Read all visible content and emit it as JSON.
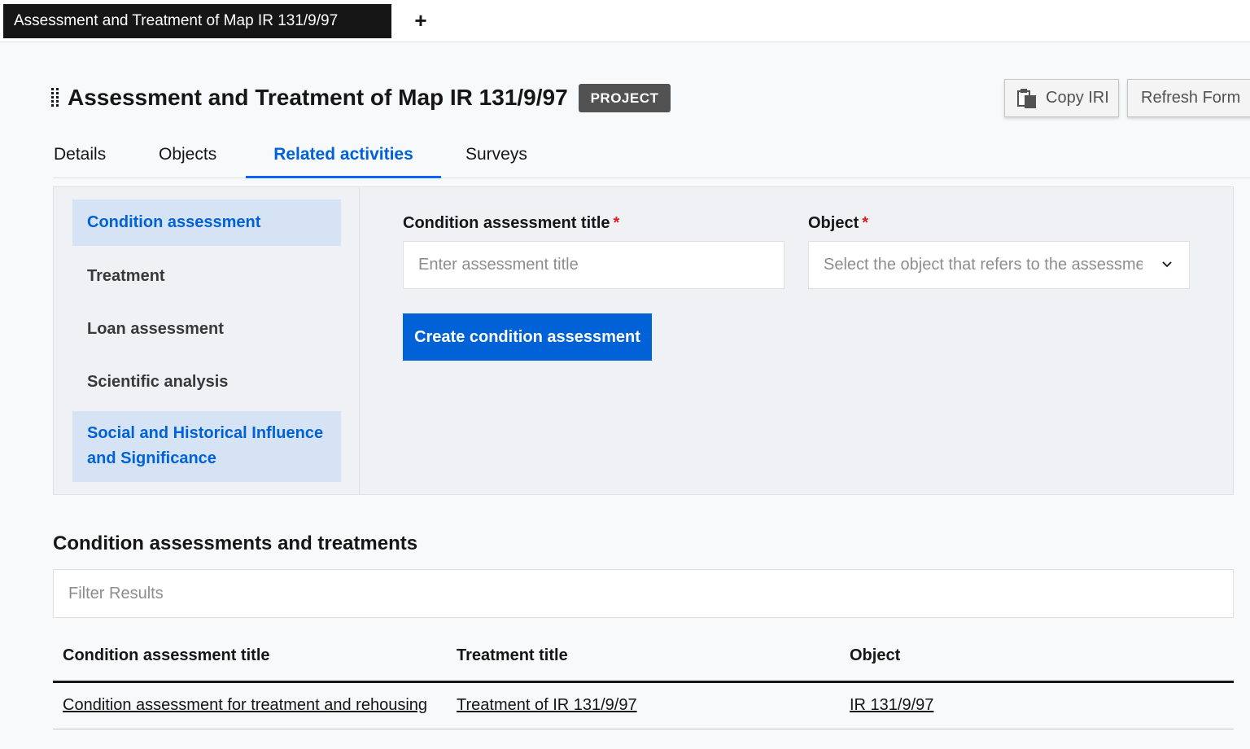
{
  "top_tabs": {
    "active_tab_label": "Assessment and Treatment of Map IR 131/9/97",
    "add_tab_symbol": "+"
  },
  "header": {
    "title": "Assessment and Treatment of Map IR 131/9/97",
    "badge": "PROJECT",
    "copy_iri_label": "Copy IRI",
    "refresh_label": "Refresh Form"
  },
  "tabs": [
    {
      "label": "Details",
      "active": false
    },
    {
      "label": "Objects",
      "active": false
    },
    {
      "label": "Related activities",
      "active": true
    },
    {
      "label": "Surveys",
      "active": false
    }
  ],
  "side_nav": [
    {
      "label": "Condition assessment",
      "selected": true
    },
    {
      "label": "Treatment",
      "selected": false
    },
    {
      "label": "Loan assessment",
      "selected": false
    },
    {
      "label": "Scientific analysis",
      "selected": false
    },
    {
      "label": "Social and Historical Influence and Significance",
      "selected": true
    }
  ],
  "form": {
    "title_label": "Condition assessment title",
    "title_placeholder": "Enter assessment title",
    "object_label": "Object",
    "object_placeholder": "Select the object that refers to the assessment",
    "required_mark": "*",
    "submit_label": "Create condition assessment"
  },
  "results": {
    "heading": "Condition assessments and treatments",
    "filter_placeholder": "Filter Results",
    "columns": [
      "Condition assessment title",
      "Treatment title",
      "Object"
    ],
    "rows": [
      {
        "assessment": "Condition assessment for treatment and rehousing",
        "treatment": "Treatment of IR 131/9/97",
        "object": "IR 131/9/97"
      }
    ]
  },
  "colors": {
    "accent": "#0062d6",
    "selected_nav_bg": "#d5e3f5",
    "badge_bg": "#525252",
    "required": "#da1e28"
  },
  "icons": {
    "copy": "copy-icon",
    "chevron": "chevron-down-icon",
    "drag": "drag-handle-icon",
    "add": "plus-icon"
  }
}
